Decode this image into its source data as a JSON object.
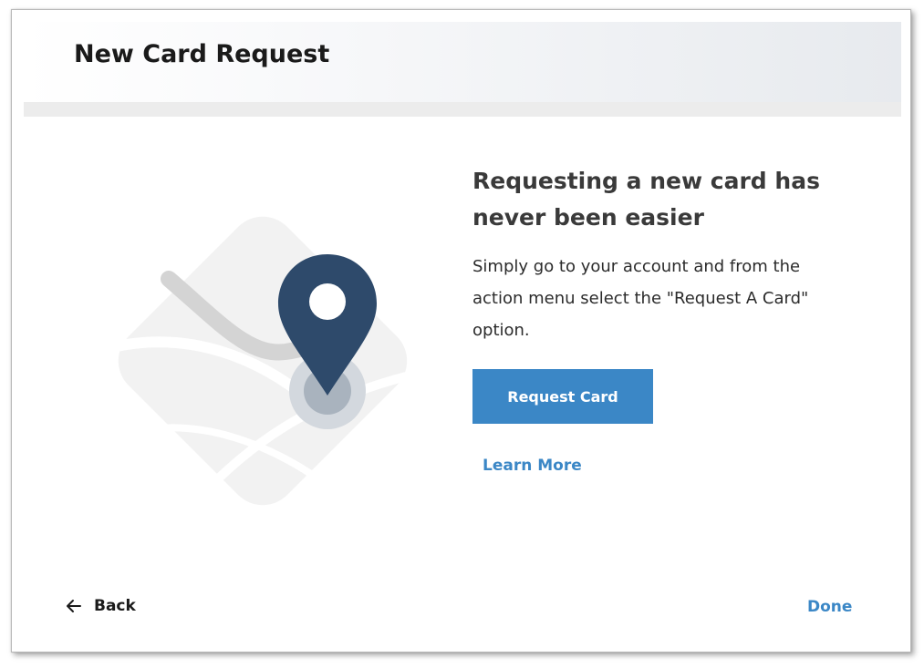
{
  "dialog": {
    "title": "New Card Request",
    "heading": "Requesting a new card has never been easier",
    "body": "Simply go to your account and from the action menu select the \"Request A Card\" option.",
    "illustration_icon": "map-pin-icon"
  },
  "actions": {
    "request_label": "Request Card",
    "learn_more_label": "Learn More"
  },
  "footer": {
    "back_label": "Back",
    "back_icon": "arrow-left-icon",
    "done_label": "Done"
  },
  "colors": {
    "accent": "#3b87c6",
    "pin": "#2e4a6b"
  }
}
